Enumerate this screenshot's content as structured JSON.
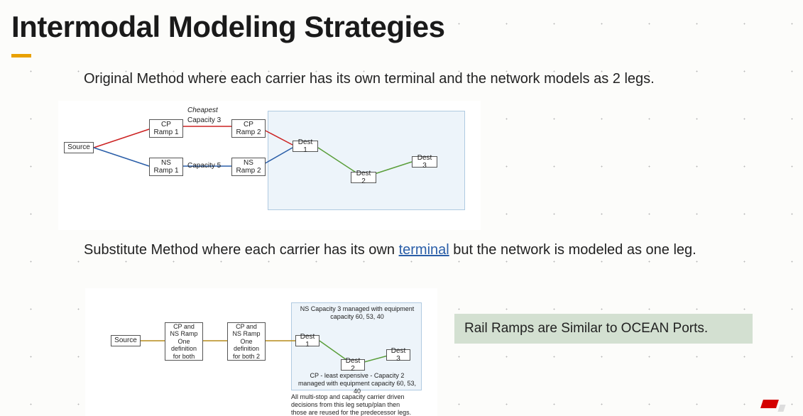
{
  "title": "Intermodal Modeling Strategies",
  "desc1": "Original Method where each carrier has its own terminal and the network models as 2 legs.",
  "desc2_pre": "Substitute Method where each carrier has its own ",
  "desc2_link": "terminal",
  "desc2_post": " but the network is modeled as one leg.",
  "callout": "Rail Ramps are Similar to OCEAN Ports.",
  "diagram1": {
    "annotations": {
      "cheapest": "Cheapest",
      "cap3": "Capacity 3",
      "cap5": "Capacity 5"
    },
    "nodes": {
      "source": "Source",
      "cp_ramp1": "CP Ramp 1",
      "ns_ramp1": "NS Ramp 1",
      "cp_ramp2": "CP Ramp 2",
      "ns_ramp2": "NS Ramp 2",
      "dest1": "Dest 1",
      "dest2": "Dest 2",
      "dest3": "Dest 3"
    }
  },
  "diagram2": {
    "annotations": {
      "ns_cap": "NS Capacity 3 managed with equipment capacity 60, 53, 40",
      "cp_cap": "CP  - least expensive - Capacity 2 managed with equipment capacity 60, 53, 40",
      "footer": "All multi-stop and capacity carrier driven decisions from this leg setup/plan then those are reused for the predecessor legs."
    },
    "nodes": {
      "source": "Source",
      "ramp1": "CP and NS Ramp  One definition for both",
      "ramp2": "CP and NS Ramp  One definition for both 2",
      "dest1": "Dest 1",
      "dest2": "Dest 2",
      "dest3": "Dest 3"
    }
  }
}
